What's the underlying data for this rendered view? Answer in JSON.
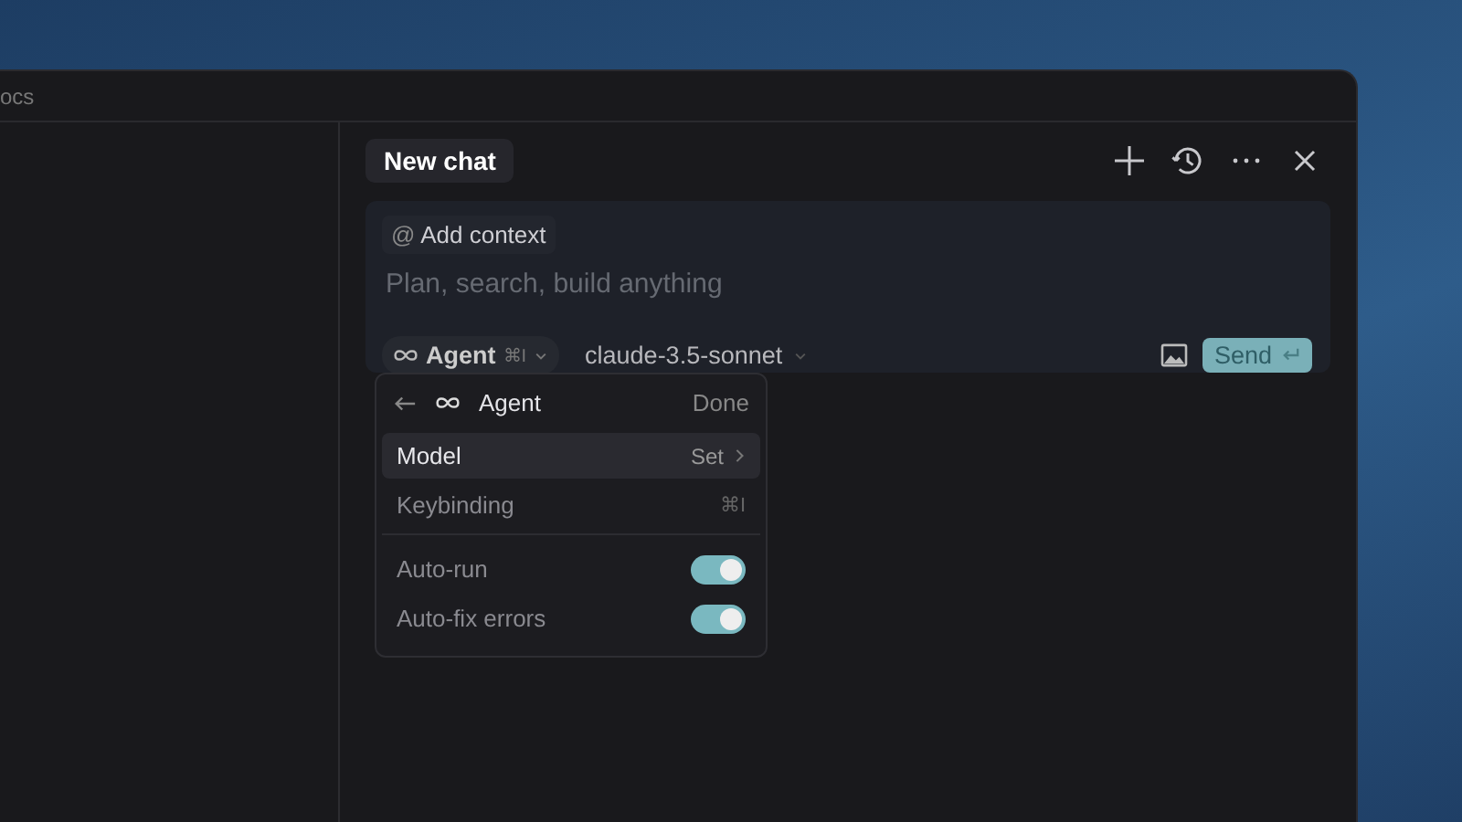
{
  "window": {
    "tab_label": "ocs"
  },
  "chat": {
    "tabs": [
      {
        "label": "New chat",
        "selected": true
      }
    ]
  },
  "composer": {
    "context_icon": "@",
    "context_button": "Add context",
    "placeholder": "Plan, search, build anything",
    "mode": {
      "label": "Agent",
      "shortcut": "⌘I"
    },
    "model": "claude-3.5-sonnet",
    "send": "Send"
  },
  "agent_menu": {
    "title": "Agent",
    "done": "Done",
    "items": [
      {
        "kind": "link",
        "label": "Model",
        "value": "Set",
        "selected": true
      },
      {
        "kind": "shortcut",
        "label": "Keybinding",
        "value": "⌘I",
        "selected": false
      },
      {
        "kind": "toggle",
        "label": "Auto-run",
        "on": true,
        "selected": false
      },
      {
        "kind": "toggle",
        "label": "Auto-fix errors",
        "on": true,
        "selected": false
      }
    ]
  }
}
